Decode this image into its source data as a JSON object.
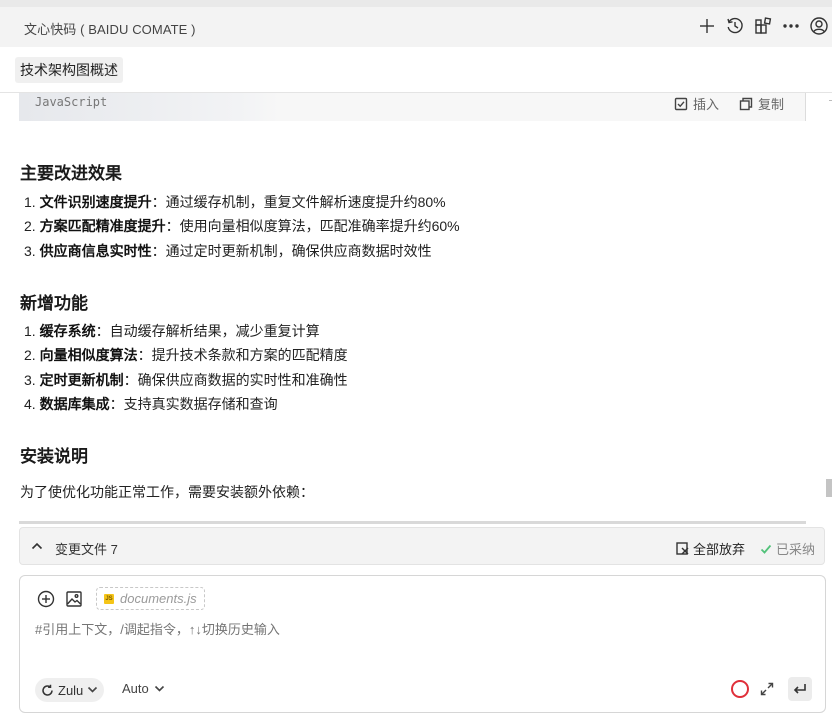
{
  "header": {
    "title": "文心快码 ( BAIDU COMATE )",
    "icons": [
      "plus-icon",
      "history-icon",
      "apps-icon",
      "more-icon",
      "user-icon"
    ]
  },
  "context_chip": "技术架构图概述",
  "code_block": {
    "language": "JavaScript",
    "insert_label": "插入",
    "copy_label": "复制"
  },
  "sections": [
    {
      "title": "主要改进效果",
      "items": [
        {
          "num": "1.",
          "bold": "文件识别速度提升",
          "text": "：通过缓存机制，重复文件解析速度提升约80%"
        },
        {
          "num": "2.",
          "bold": "方案匹配精准度提升",
          "text": "：使用向量相似度算法，匹配准确率提升约60%"
        },
        {
          "num": "3.",
          "bold": "供应商信息实时性",
          "text": "：通过定时更新机制，确保供应商数据时效性"
        }
      ]
    },
    {
      "title": "新增功能",
      "items": [
        {
          "num": "1.",
          "bold": "缓存系统",
          "text": "：自动缓存解析结果，减少重复计算"
        },
        {
          "num": "2.",
          "bold": "向量相似度算法",
          "text": "：提升技术条款和方案的匹配精度"
        },
        {
          "num": "3.",
          "bold": "定时更新机制",
          "text": "：确保供应商数据的实时性和准确性"
        },
        {
          "num": "4.",
          "bold": "数据库集成",
          "text": "：支持真实数据存储和查询"
        }
      ]
    },
    {
      "title": "安装说明",
      "paragraph": "为了使优化功能正常工作，需要安装额外依赖："
    }
  ],
  "changes_bar": {
    "label": "变更文件 7",
    "discard_all": "全部放弃",
    "adopted": "已采纳"
  },
  "input": {
    "file_chip": "documents.js",
    "file_badge": "JS",
    "placeholder": "#引用上下文，/调起指令，↑↓切换历史输入",
    "model": "Zulu",
    "mode": "Auto"
  },
  "colors": {
    "record_ring": "#e0303a",
    "adopted_check": "#52c27a",
    "js_badge": "#f5c518"
  }
}
